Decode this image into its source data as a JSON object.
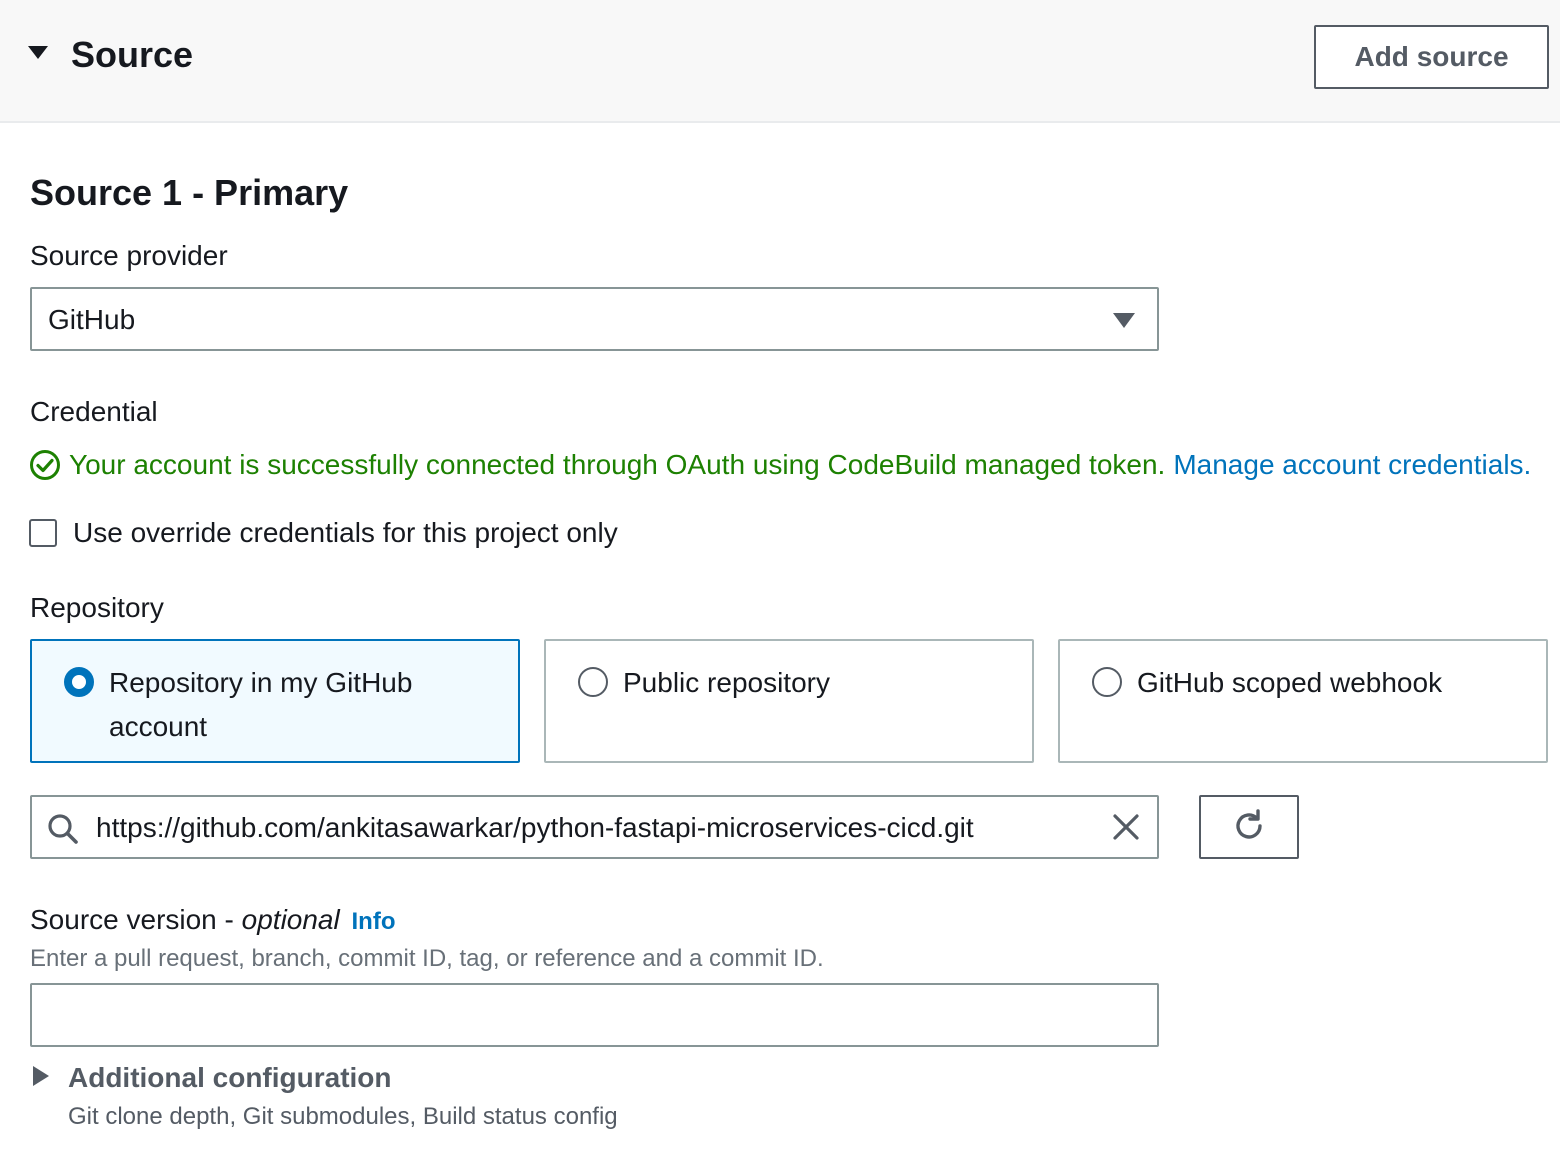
{
  "header": {
    "title": "Source",
    "add_source_label": "Add source"
  },
  "primary": {
    "title": "Source 1 - Primary",
    "source_provider": {
      "label": "Source provider",
      "value": "GitHub"
    },
    "credential": {
      "label": "Credential",
      "message": "Your account is successfully connected through OAuth using CodeBuild managed token.",
      "link": "Manage account credentials."
    },
    "override_checkbox": {
      "label": "Use override credentials for this project only",
      "checked": false
    },
    "repository": {
      "label": "Repository",
      "options": [
        {
          "label": "Repository in my GitHub account",
          "selected": true
        },
        {
          "label": "Public repository",
          "selected": false
        },
        {
          "label": "GitHub scoped webhook",
          "selected": false
        }
      ],
      "search_value": "https://github.com/ankitasawarkar/python-fastapi-microservices-cicd.git"
    },
    "source_version": {
      "label": "Source version - ",
      "optional": "optional",
      "info": "Info",
      "description": "Enter a pull request, branch, commit ID, tag, or reference and a commit ID.",
      "value": ""
    },
    "additional_config": {
      "title": "Additional configuration",
      "description": "Git clone depth, Git submodules, Build status config"
    }
  },
  "colors": {
    "link": "#0073bb",
    "success": "#1d8102",
    "selected_bg": "#f1faff"
  }
}
